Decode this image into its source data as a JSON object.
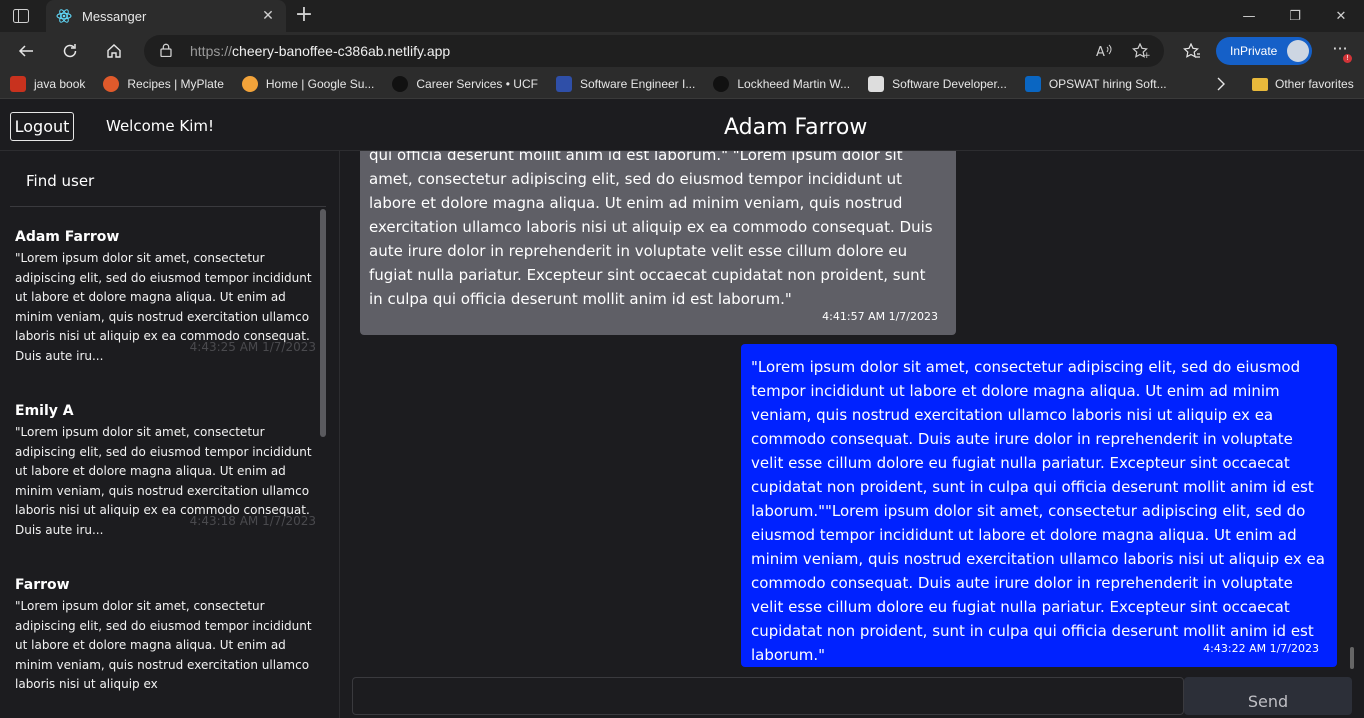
{
  "browser": {
    "tab_title": "Messanger",
    "url_prefix": "https://",
    "url_host": "cheery-banoffee-c386ab.netlify.app",
    "inprivate_label": "InPrivate",
    "bookmarks": [
      {
        "label": "java book",
        "icon": "pdf-icon",
        "color": "#c8321e"
      },
      {
        "label": "Recipes | MyPlate",
        "icon": "myplate-icon",
        "color": "#e05a2b"
      },
      {
        "label": "Home | Google Su...",
        "icon": "gear-icon",
        "color": "#f2a33a"
      },
      {
        "label": "Career Services • UCF",
        "icon": "ucf-icon",
        "color": "#222222"
      },
      {
        "label": "Software Engineer I...",
        "icon": "lockheed-star-icon",
        "color": "#2f4fa8"
      },
      {
        "label": "Lockheed Martin W...",
        "icon": "ucf-icon",
        "color": "#222222"
      },
      {
        "label": "Software Developer...",
        "icon": "page-icon",
        "color": "#dddddd"
      },
      {
        "label": "OPSWAT hiring Soft...",
        "icon": "linkedin-icon",
        "color": "#0a66c2"
      }
    ],
    "other_favorites": "Other favorites"
  },
  "header": {
    "logout_label": "Logout",
    "welcome": "Welcome Kim!",
    "chat_title": "Adam Farrow"
  },
  "sidebar": {
    "find_user_label": "Find user",
    "conversations": [
      {
        "name": "Adam Farrow",
        "preview": "\"Lorem ipsum dolor sit amet, consectetur adipiscing elit, sed do eiusmod tempor incididunt ut labore et dolore magna aliqua. Ut enim ad minim veniam, quis nostrud exercitation ullamco laboris nisi ut aliquip ex ea commodo consequat. Duis aute iru...",
        "time": "4:43:25 AM 1/7/2023"
      },
      {
        "name": "Emily A",
        "preview": "\"Lorem ipsum dolor sit amet, consectetur adipiscing elit, sed do eiusmod tempor incididunt ut labore et dolore magna aliqua. Ut enim ad minim veniam, quis nostrud exercitation ullamco laboris nisi ut aliquip ex ea commodo consequat. Duis aute iru...",
        "time": "4:43:18 AM 1/7/2023"
      },
      {
        "name": "Farrow",
        "preview": "\"Lorem ipsum dolor sit amet, consectetur adipiscing elit, sed do eiusmod tempor incididunt ut labore et dolore magna aliqua. Ut enim ad minim veniam, quis nostrud exercitation ullamco laboris nisi ut aliquip ex",
        "time": ""
      }
    ]
  },
  "messages": [
    {
      "direction": "incoming",
      "text": "qui officia deserunt mollit anim id est laborum.\" \"Lorem ipsum dolor sit amet, consectetur adipiscing elit, sed do eiusmod tempor incididunt ut labore et dolore magna aliqua. Ut enim ad minim veniam, quis nostrud exercitation ullamco laboris nisi ut aliquip ex ea commodo consequat. Duis aute irure dolor in reprehenderit in voluptate velit esse cillum dolore eu fugiat nulla pariatur. Excepteur sint occaecat cupidatat non proident, sunt in culpa qui officia deserunt mollit anim id est laborum.\"",
      "time": "4:41:57 AM 1/7/2023"
    },
    {
      "direction": "outgoing",
      "text": "\"Lorem ipsum dolor sit amet, consectetur adipiscing elit, sed do eiusmod tempor incididunt ut labore et dolore magna aliqua. Ut enim ad minim veniam, quis nostrud exercitation ullamco laboris nisi ut aliquip ex ea commodo consequat. Duis aute irure dolor in reprehenderit in voluptate velit esse cillum dolore eu fugiat nulla pariatur. Excepteur sint occaecat cupidatat non proident, sunt in culpa qui officia deserunt mollit anim id est laborum.\"\"Lorem ipsum dolor sit amet, consectetur adipiscing elit, sed do eiusmod tempor incididunt ut labore et dolore magna aliqua. Ut enim ad minim veniam, quis nostrud exercitation ullamco laboris nisi ut aliquip ex ea commodo consequat. Duis aute irure dolor in reprehenderit in voluptate velit esse cillum dolore eu fugiat nulla pariatur. Excepteur sint occaecat cupidatat non proident, sunt in culpa qui officia deserunt mollit anim id est laborum.\"",
      "time": "4:43:22 AM 1/7/2023"
    }
  ],
  "composer": {
    "input_value": "",
    "send_label": "Send"
  }
}
